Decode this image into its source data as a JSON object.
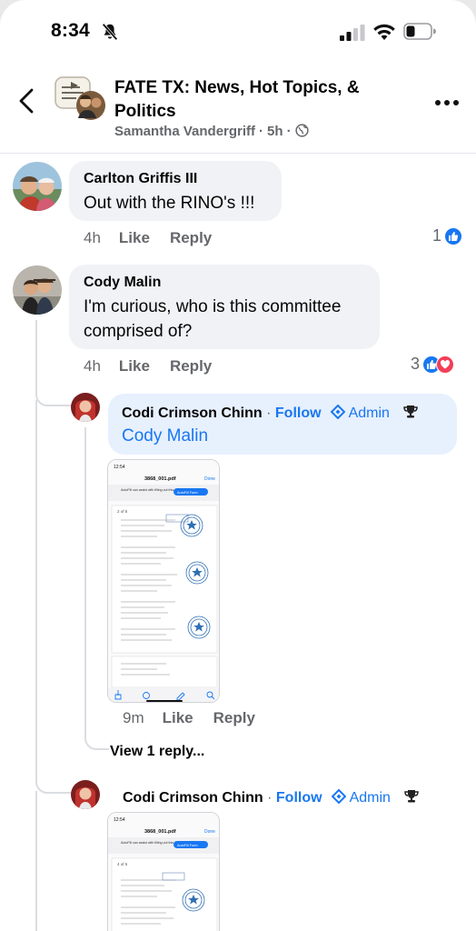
{
  "status": {
    "time": "8:34"
  },
  "header": {
    "title": "FATE TX: News, Hot Topics, & Politics",
    "author": "Samantha Vandergriff",
    "time": "5h",
    "separator": "·"
  },
  "comments": [
    {
      "author": "Carlton Griffis III",
      "text": "Out with the RINO's !!!",
      "time": "4h",
      "like": "Like",
      "reply": "Reply",
      "reactions": "1"
    },
    {
      "author": "Cody Malin",
      "text": "I'm curious, who is this committee comprised of?",
      "time": "4h",
      "like": "Like",
      "reply": "Reply",
      "reactions": "3"
    }
  ],
  "replies": [
    {
      "author": "Codi Crimson Chinn",
      "follow": "Follow",
      "admin": "Admin",
      "mention": "Cody Malin",
      "time": "9m",
      "like": "Like",
      "reply": "Reply"
    },
    {
      "author": "Codi Crimson Chinn",
      "follow": "Follow",
      "admin": "Admin"
    }
  ],
  "view_replies": "View 1 reply...",
  "attachment": {
    "status_time": "12:54",
    "filename": "3868_001.pdf",
    "done": "Done",
    "autofill_text": "AutoFill can assist with filling out this form.",
    "autofill_button": "AutoFill Form",
    "page_indicator_1": "2 of 5",
    "page_indicator_2": "4 of 5"
  },
  "icons": [
    "bell-slash-icon",
    "signal-icon",
    "wifi-icon",
    "battery-icon",
    "back-chevron-icon",
    "more-icon",
    "globe-icon",
    "like-icon",
    "love-icon",
    "admin-diamond-icon",
    "trophy-icon"
  ],
  "colors": {
    "accent": "#1877f2",
    "love": "#f33e58",
    "bubble": "#f0f2f5",
    "muted": "#65676b"
  }
}
